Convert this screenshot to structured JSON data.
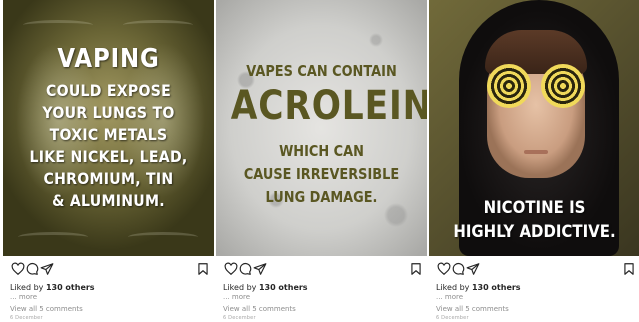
{
  "posts": [
    {
      "headline": "VAPING",
      "body_lines": [
        "COULD EXPOSE",
        "YOUR LUNGS TO",
        "TOXIC METALS",
        "LIKE NICKEL, LEAD,",
        "CHROMIUM, TIN",
        "& ALUMINUM."
      ],
      "likes_prefix": "Liked by ",
      "likes_count": "130 others",
      "more": "... more",
      "comments": "View all 5 comments",
      "date": "6 December"
    },
    {
      "headline_small": "VAPES CAN CONTAIN",
      "headline": "ACROLEIN",
      "body_lines": [
        "WHICH CAN",
        "CAUSE IRREVERSIBLE",
        "LUNG DAMAGE."
      ],
      "likes_prefix": "Liked by ",
      "likes_count": "130 others",
      "more": "... more",
      "comments": "View all 5 comments",
      "date": "6 December"
    },
    {
      "body_lines": [
        "NICOTINE IS",
        "HIGHLY ADDICTIVE."
      ],
      "likes_prefix": "Liked by ",
      "likes_count": "130 others",
      "more": "... more",
      "comments": "View all 5 comments",
      "date": "6 December"
    }
  ],
  "icons": [
    "heart-icon",
    "comment-icon",
    "share-icon",
    "bookmark-icon"
  ],
  "colors": {
    "post1_text": "#ffffff",
    "post2_text": "#5a5722",
    "post3_eyes": "#f0d95a",
    "meta_grey": "#8e8e8e"
  }
}
